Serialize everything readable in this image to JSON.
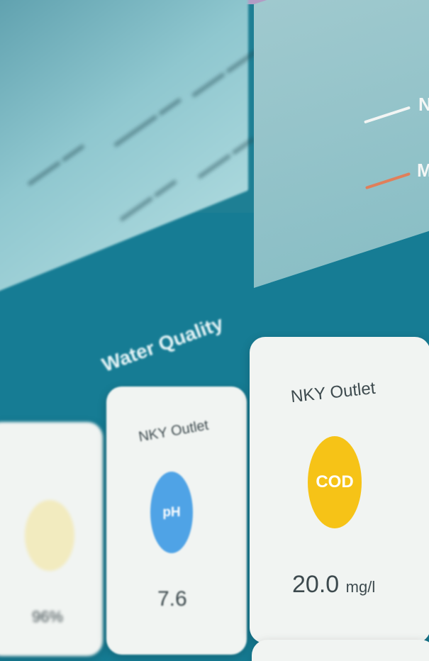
{
  "legend": {
    "items": [
      {
        "label": "N",
        "color": "#f2f5f4"
      },
      {
        "label": "M",
        "color": "#e07f5a"
      }
    ]
  },
  "section": {
    "title": "Water Quality"
  },
  "cards": [
    {
      "title": "",
      "badge": "",
      "badge_color": "#f3d46a",
      "value": "96%"
    },
    {
      "title": "NKY Outlet",
      "badge": "pH",
      "badge_color": "#4fa3e6",
      "value": "7.6"
    },
    {
      "title": "NKY Outlet",
      "badge": "COD",
      "badge_color": "#f6c317",
      "value": "20.0",
      "unit": "mg/l"
    }
  ],
  "colors": {
    "accent": "#167c94",
    "card": "#f1f4f2"
  }
}
